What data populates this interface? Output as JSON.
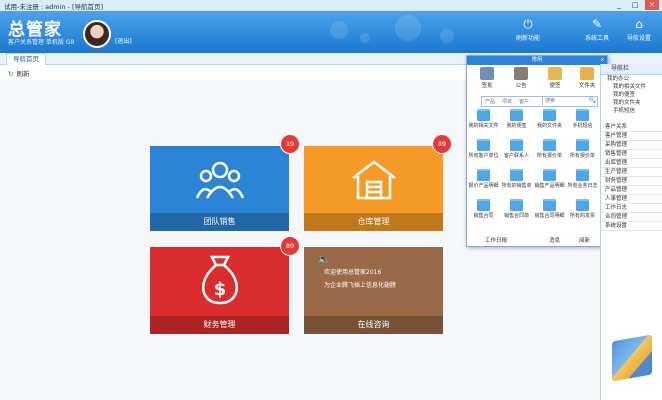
{
  "window": {
    "title": "试用-未注册 : admin - [导航首页]",
    "controls": [
      "_",
      "□",
      "✕"
    ]
  },
  "header": {
    "logo": "总管家",
    "subtitle": "客户关系管理 单机版 G8",
    "logout": "[退出]",
    "buttons": [
      {
        "label": "刷新功能",
        "icon": "power-icon"
      },
      {
        "label": "系统工具",
        "icon": "tools-icon"
      },
      {
        "label": "导航设置",
        "icon": "home-gear-icon"
      }
    ]
  },
  "tab": {
    "label": "导航首页"
  },
  "toolbar": {
    "refresh": "刷新"
  },
  "tiles": [
    {
      "label": "团队销售",
      "badge": "19",
      "color": "#2c84d6"
    },
    {
      "label": "仓库管理",
      "badge": "89",
      "color": "#f59a24"
    },
    {
      "label": "财务管理",
      "badge": "89",
      "color": "#db2d2d"
    },
    {
      "label": "在线咨询",
      "color": "#9a6a48",
      "news": [
        "欢迎使用总管家2016",
        "为企业腾飞插上信息化翅膀"
      ]
    }
  ],
  "panel": {
    "title": "常用",
    "close": "x",
    "quick": [
      {
        "label": "签批",
        "color": "#6e8fb7"
      },
      {
        "label": "公告",
        "color": "#8a7c6e"
      },
      {
        "label": "便签",
        "color": "#e6b84a"
      },
      {
        "label": "文件夹",
        "color": "#e9b145"
      }
    ],
    "search": {
      "options": [
        "产品",
        "项目",
        "客户"
      ],
      "placeholder": "搜索",
      "button": "🔍"
    },
    "items": [
      "我的相关文件",
      "我的便签",
      "我的文件夹",
      "手机短信",
      "所有客户单位",
      "客户联系人",
      "所有报价单",
      "所有报价单",
      "报价产品明细",
      "所有的销售单",
      "销售产品明细",
      "所有业务日志",
      "销售合同",
      "销售合同单",
      "销售合同明细",
      "所有的发票"
    ],
    "footer": {
      "left": "工作日报",
      "msg": "消息",
      "nav": "阅新"
    }
  },
  "side": {
    "header": "导航栏",
    "children": [
      "我的办公",
      "我的相关文件",
      "我的便签",
      "我的文件夹",
      "手机短信"
    ],
    "sections": [
      "客户关系",
      "客户管理",
      "采购管理",
      "销售管理",
      "出库管理",
      "生产管理",
      "财务管理",
      "产品管理",
      "人事管理",
      "工作日志",
      "合同管理",
      "系统设置"
    ]
  }
}
